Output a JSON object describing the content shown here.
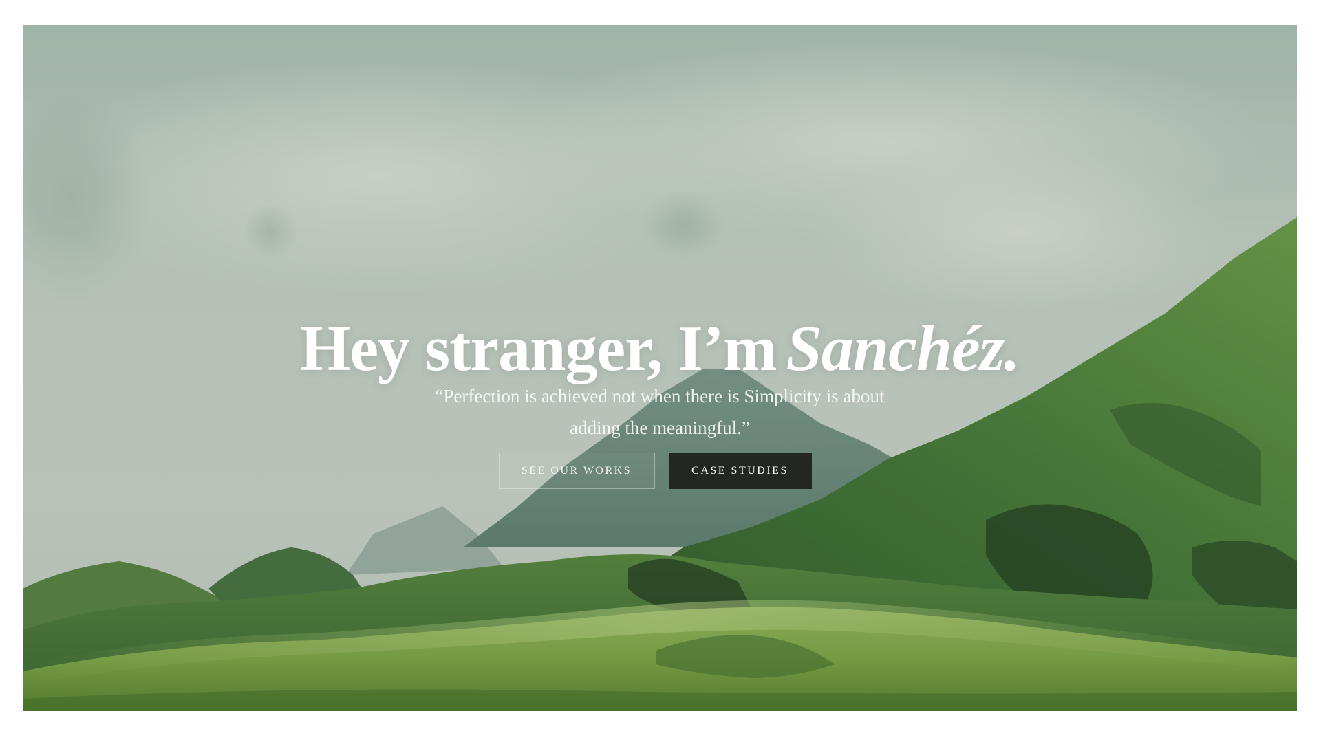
{
  "hero": {
    "headline_main": "Hey stranger, I’m",
    "headline_name": "Sanchéz.",
    "quote": "“Perfection is achieved not when there is Simplicity is about adding the meaningful.”",
    "background_image": "misty-green-mountain-landscape"
  },
  "buttons": {
    "primary_label": "SEE OUR WORKS",
    "secondary_label": "CASE STUDIES"
  },
  "colors": {
    "sky": "#a2b3a9",
    "mountain_dark": "#2e5a2a",
    "meadow": "#6f9a3e",
    "button_dark": "#232723",
    "text": "#ffffff"
  }
}
